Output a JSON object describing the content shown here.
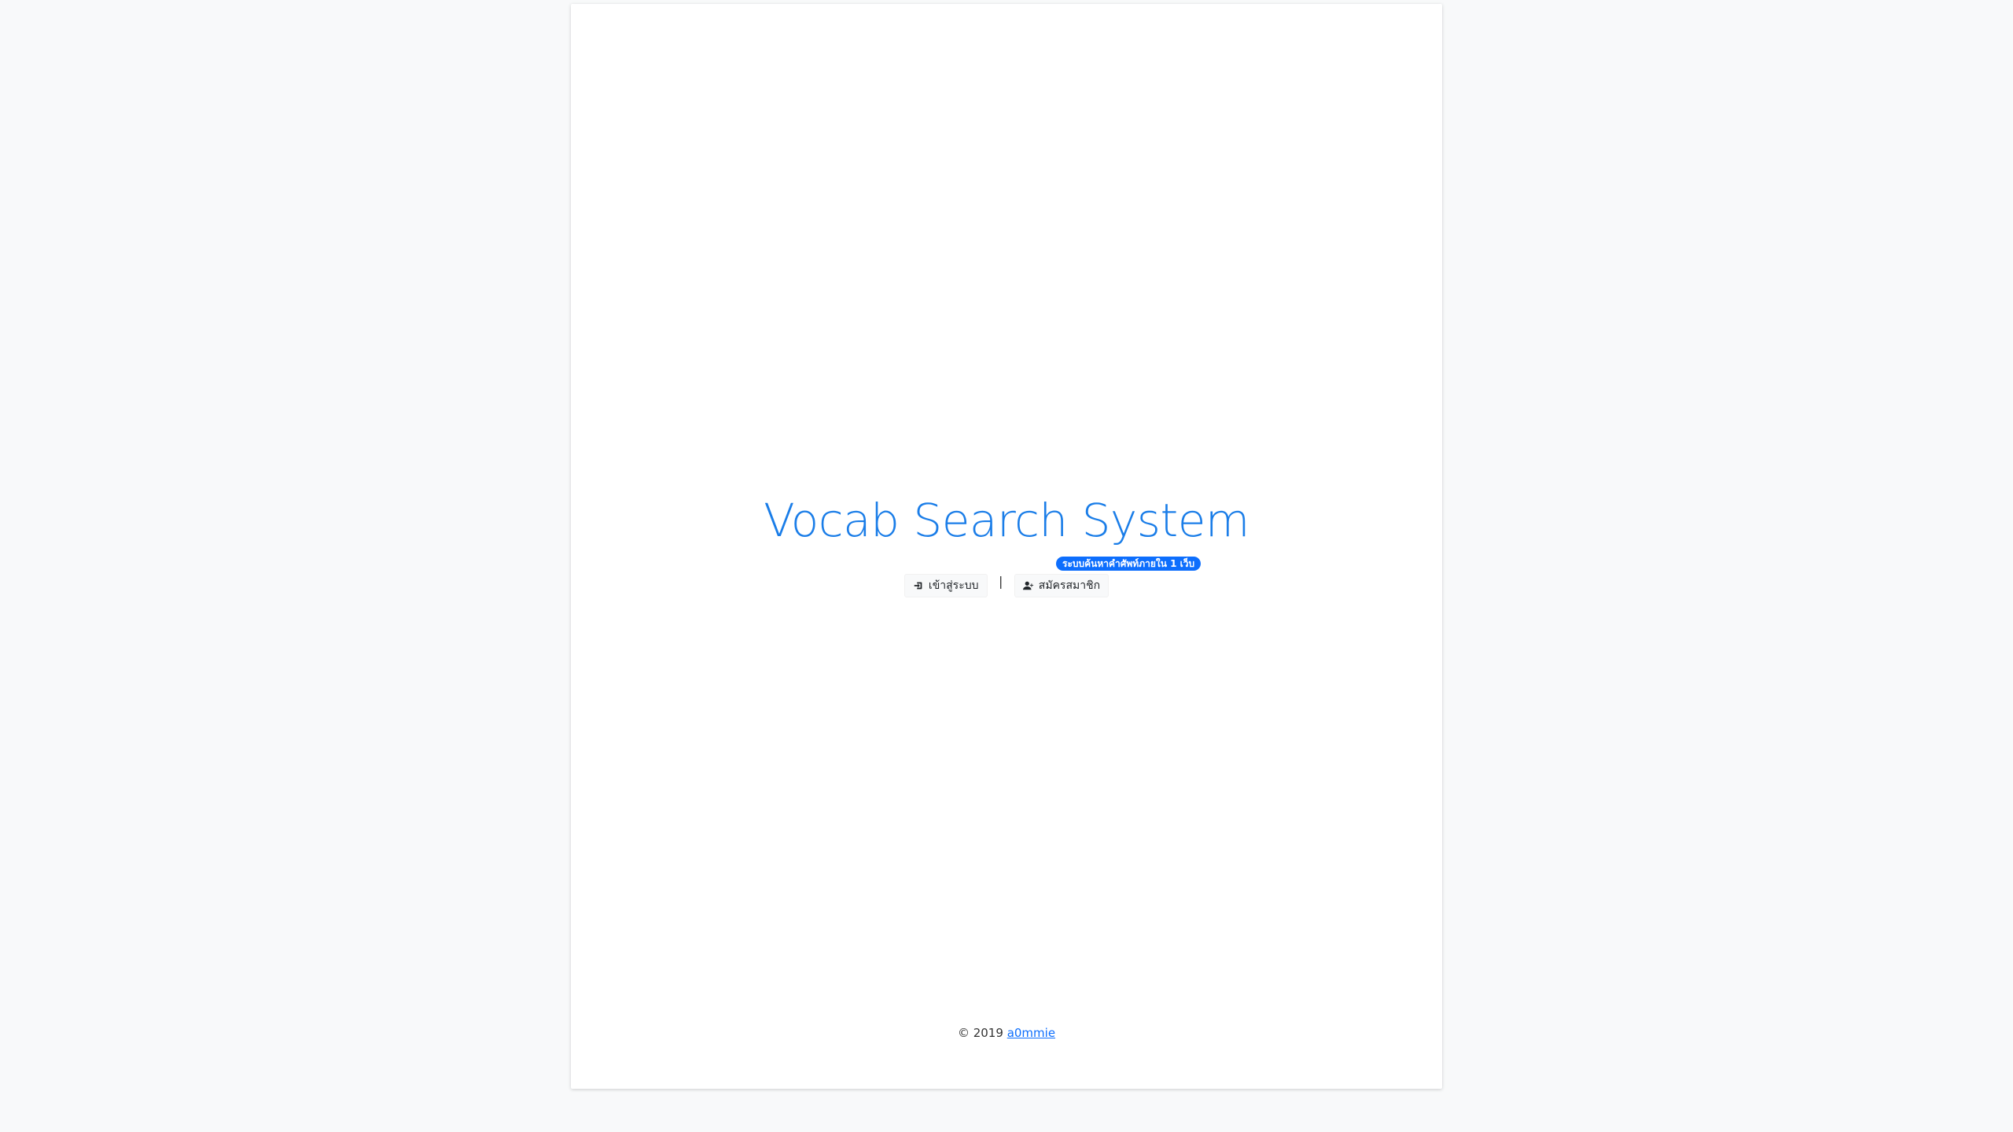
{
  "app": {
    "title": "Vocab Search System",
    "tagline": "ระบบค้นหาคำศัพท์ภายใน 1 เว็บ",
    "accent_color": "#1a7de8",
    "badge_color": "#0d6efd"
  },
  "actions": {
    "login_label": "เข้าสู่ระบบ",
    "login_icon": "sign-in-icon",
    "separator": "|",
    "register_label": "สมัครสมาชิก",
    "register_icon": "user-plus-icon"
  },
  "footer": {
    "copyright": "© 2019",
    "author_link": "a0mmie"
  }
}
